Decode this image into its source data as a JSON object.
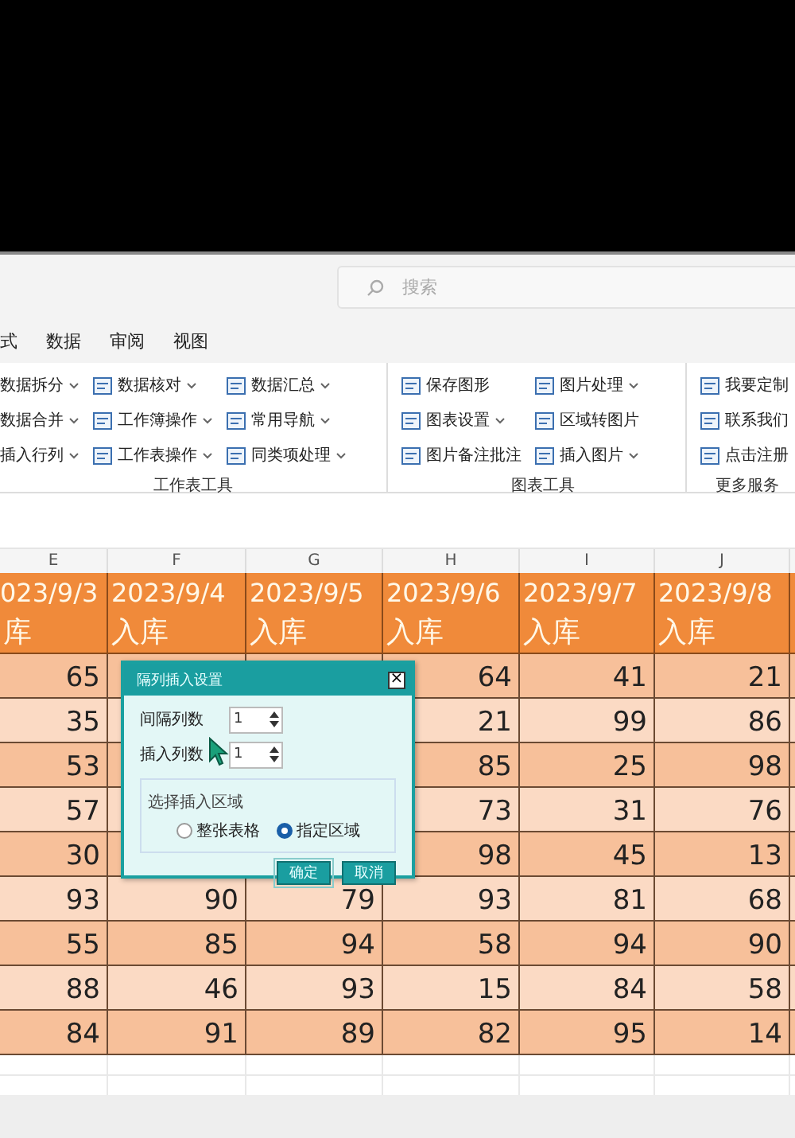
{
  "search": {
    "placeholder": "搜索"
  },
  "menu_tabs": [
    "式",
    "数据",
    "审阅",
    "视图"
  ],
  "ribbon": {
    "groups": [
      {
        "label": "工作表工具",
        "columns": [
          [
            {
              "label": "数据拆分",
              "dropdown": true,
              "icon": false
            },
            {
              "label": "数据合并",
              "dropdown": true,
              "icon": false
            },
            {
              "label": "插入行列",
              "dropdown": true,
              "icon": false
            }
          ],
          [
            {
              "label": "数据核对",
              "dropdown": true,
              "icon": true
            },
            {
              "label": "工作簿操作",
              "dropdown": true,
              "icon": true
            },
            {
              "label": "工作表操作",
              "dropdown": true,
              "icon": true
            }
          ],
          [
            {
              "label": "数据汇总",
              "dropdown": true,
              "icon": true
            },
            {
              "label": "常用导航",
              "dropdown": true,
              "icon": true
            },
            {
              "label": "同类项处理",
              "dropdown": true,
              "icon": true
            }
          ]
        ]
      },
      {
        "label": "图表工具",
        "columns": [
          [
            {
              "label": "保存图形",
              "dropdown": false,
              "icon": true
            },
            {
              "label": "图表设置",
              "dropdown": true,
              "icon": true
            },
            {
              "label": "图片备注批注",
              "dropdown": false,
              "icon": true
            }
          ],
          [
            {
              "label": "图片处理",
              "dropdown": true,
              "icon": true
            },
            {
              "label": "区域转图片",
              "dropdown": false,
              "icon": true
            },
            {
              "label": "插入图片",
              "dropdown": true,
              "icon": true
            }
          ]
        ]
      },
      {
        "label": "更多服务",
        "columns": [
          [
            {
              "label": "我要定制",
              "dropdown": false,
              "icon": true
            },
            {
              "label": "联系我们",
              "dropdown": false,
              "icon": true
            },
            {
              "label": "点击注册",
              "dropdown": false,
              "icon": true
            }
          ]
        ]
      }
    ]
  },
  "sheet": {
    "columns": [
      "E",
      "F",
      "G",
      "H",
      "I",
      "J"
    ],
    "date_row": [
      "023/9/3",
      "2023/9/4",
      "2023/9/5",
      "2023/9/6",
      "2023/9/7",
      "2023/9/8"
    ],
    "type_row": [
      "库",
      "入库",
      "入库",
      "入库",
      "入库",
      "入库"
    ],
    "rows": [
      [
        "65",
        null,
        null,
        "64",
        "41",
        "21"
      ],
      [
        "35",
        null,
        null,
        "21",
        "99",
        "86"
      ],
      [
        "53",
        null,
        null,
        "85",
        "25",
        "98"
      ],
      [
        "57",
        null,
        null,
        "73",
        "31",
        "76"
      ],
      [
        "30",
        null,
        null,
        "98",
        "45",
        "13"
      ],
      [
        "93",
        "90",
        "79",
        "93",
        "81",
        "68"
      ],
      [
        "55",
        "85",
        "94",
        "58",
        "94",
        "90"
      ],
      [
        "88",
        "46",
        "93",
        "15",
        "84",
        "58"
      ],
      [
        "84",
        "91",
        "89",
        "82",
        "95",
        "14"
      ]
    ]
  },
  "dialog": {
    "title": "隔列插入设置",
    "close": "×",
    "fields": [
      {
        "label": "间隔列数",
        "value": "1"
      },
      {
        "label": "插入列数",
        "value": "1"
      }
    ],
    "region": {
      "label": "选择插入区域",
      "options": [
        {
          "label": "整张表格",
          "selected": false
        },
        {
          "label": "指定区域",
          "selected": true
        }
      ]
    },
    "buttons": [
      "确定",
      "取消"
    ]
  }
}
